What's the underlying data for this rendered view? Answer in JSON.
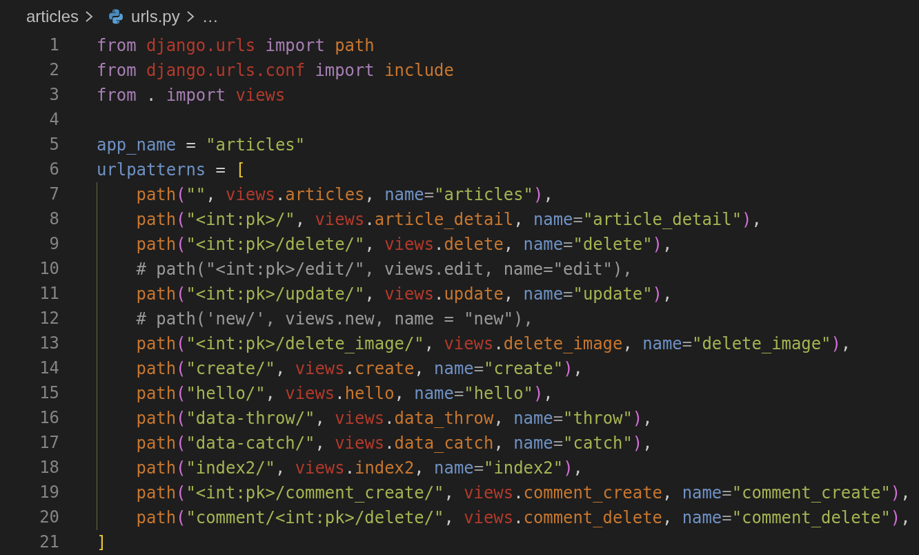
{
  "breadcrumb": {
    "folder": "articles",
    "file": "urls.py",
    "more": "…"
  },
  "lines": [
    {
      "number": "1",
      "indented": false,
      "tokens": [
        {
          "text": "from ",
          "kind": "kw"
        },
        {
          "text": "django.",
          "kind": "mod"
        },
        {
          "text": "urls ",
          "kind": "mod"
        },
        {
          "text": "import ",
          "kind": "kw"
        },
        {
          "text": "path",
          "kind": "fn"
        }
      ]
    },
    {
      "number": "2",
      "indented": false,
      "tokens": [
        {
          "text": "from ",
          "kind": "kw"
        },
        {
          "text": "django.",
          "kind": "mod"
        },
        {
          "text": "urls.",
          "kind": "mod"
        },
        {
          "text": "conf ",
          "kind": "mod"
        },
        {
          "text": "import ",
          "kind": "kw"
        },
        {
          "text": "include",
          "kind": "fn"
        }
      ]
    },
    {
      "number": "3",
      "indented": false,
      "tokens": [
        {
          "text": "from ",
          "kind": "kw"
        },
        {
          "text": ". ",
          "kind": "pl"
        },
        {
          "text": "import ",
          "kind": "kw"
        },
        {
          "text": "views",
          "kind": "mod"
        }
      ]
    },
    {
      "number": "4"
    },
    {
      "number": "5",
      "indented": false,
      "tokens": [
        {
          "text": "app_name",
          "kind": "var"
        },
        {
          "text": " = ",
          "kind": "pl"
        },
        {
          "text": "\"articles\"",
          "kind": "str"
        }
      ]
    },
    {
      "number": "6",
      "indented": false,
      "tokens": [
        {
          "text": "urlpatterns",
          "kind": "var"
        },
        {
          "text": " = ",
          "kind": "pl"
        },
        {
          "text": "[",
          "kind": "brk"
        }
      ]
    },
    {
      "number": "7",
      "indented": true,
      "tokens": [
        {
          "text": "path",
          "kind": "fn"
        },
        {
          "text": "(",
          "kind": "paren"
        },
        {
          "text": "\"\"",
          "kind": "str"
        },
        {
          "text": ", ",
          "kind": "pl"
        },
        {
          "text": "views",
          "kind": "mod"
        },
        {
          "text": ".",
          "kind": "pl"
        },
        {
          "text": "articles",
          "kind": "fn"
        },
        {
          "text": ", ",
          "kind": "pl"
        },
        {
          "text": "name",
          "kind": "par"
        },
        {
          "text": "=",
          "kind": "op"
        },
        {
          "text": "\"articles\"",
          "kind": "str"
        },
        {
          "text": ")",
          "kind": "paren"
        },
        {
          "text": ",",
          "kind": "pl"
        }
      ]
    },
    {
      "number": "8",
      "indented": true,
      "tokens": [
        {
          "text": "path",
          "kind": "fn"
        },
        {
          "text": "(",
          "kind": "paren"
        },
        {
          "text": "\"<int:pk>/\"",
          "kind": "str"
        },
        {
          "text": ", ",
          "kind": "pl"
        },
        {
          "text": "views",
          "kind": "mod"
        },
        {
          "text": ".",
          "kind": "pl"
        },
        {
          "text": "article_detail",
          "kind": "fn"
        },
        {
          "text": ", ",
          "kind": "pl"
        },
        {
          "text": "name",
          "kind": "par"
        },
        {
          "text": "=",
          "kind": "op"
        },
        {
          "text": "\"article_detail\"",
          "kind": "str"
        },
        {
          "text": ")",
          "kind": "paren"
        },
        {
          "text": ",",
          "kind": "pl"
        }
      ]
    },
    {
      "number": "9",
      "indented": true,
      "tokens": [
        {
          "text": "path",
          "kind": "fn"
        },
        {
          "text": "(",
          "kind": "paren"
        },
        {
          "text": "\"<int:pk>/delete/\"",
          "kind": "str"
        },
        {
          "text": ", ",
          "kind": "pl"
        },
        {
          "text": "views",
          "kind": "mod"
        },
        {
          "text": ".",
          "kind": "pl"
        },
        {
          "text": "delete",
          "kind": "fn"
        },
        {
          "text": ", ",
          "kind": "pl"
        },
        {
          "text": "name",
          "kind": "par"
        },
        {
          "text": "=",
          "kind": "op"
        },
        {
          "text": "\"delete\"",
          "kind": "str"
        },
        {
          "text": ")",
          "kind": "paren"
        },
        {
          "text": ",",
          "kind": "pl"
        }
      ]
    },
    {
      "number": "10",
      "indented": true,
      "tokens": [
        {
          "text": "# path(\"<int:pk>/edit/\", views.edit, name=\"edit\"),",
          "kind": "cm"
        }
      ]
    },
    {
      "number": "11",
      "indented": true,
      "tokens": [
        {
          "text": "path",
          "kind": "fn"
        },
        {
          "text": "(",
          "kind": "paren"
        },
        {
          "text": "\"<int:pk>/update/\"",
          "kind": "str"
        },
        {
          "text": ", ",
          "kind": "pl"
        },
        {
          "text": "views",
          "kind": "mod"
        },
        {
          "text": ".",
          "kind": "pl"
        },
        {
          "text": "update",
          "kind": "fn"
        },
        {
          "text": ", ",
          "kind": "pl"
        },
        {
          "text": "name",
          "kind": "par"
        },
        {
          "text": "=",
          "kind": "op"
        },
        {
          "text": "\"update\"",
          "kind": "str"
        },
        {
          "text": ")",
          "kind": "paren"
        },
        {
          "text": ",",
          "kind": "pl"
        }
      ]
    },
    {
      "number": "12",
      "indented": true,
      "tokens": [
        {
          "text": "# path('new/', views.new, name = \"new\"),",
          "kind": "cm"
        }
      ]
    },
    {
      "number": "13",
      "indented": true,
      "tokens": [
        {
          "text": "path",
          "kind": "fn"
        },
        {
          "text": "(",
          "kind": "paren"
        },
        {
          "text": "\"<int:pk>/delete_image/\"",
          "kind": "str"
        },
        {
          "text": ", ",
          "kind": "pl"
        },
        {
          "text": "views",
          "kind": "mod"
        },
        {
          "text": ".",
          "kind": "pl"
        },
        {
          "text": "delete_image",
          "kind": "fn"
        },
        {
          "text": ", ",
          "kind": "pl"
        },
        {
          "text": "name",
          "kind": "par"
        },
        {
          "text": "=",
          "kind": "op"
        },
        {
          "text": "\"delete_image\"",
          "kind": "str"
        },
        {
          "text": ")",
          "kind": "paren"
        },
        {
          "text": ",",
          "kind": "pl"
        }
      ]
    },
    {
      "number": "14",
      "indented": true,
      "tokens": [
        {
          "text": "path",
          "kind": "fn"
        },
        {
          "text": "(",
          "kind": "paren"
        },
        {
          "text": "\"create/\"",
          "kind": "str"
        },
        {
          "text": ", ",
          "kind": "pl"
        },
        {
          "text": "views",
          "kind": "mod"
        },
        {
          "text": ".",
          "kind": "pl"
        },
        {
          "text": "create",
          "kind": "fn"
        },
        {
          "text": ", ",
          "kind": "pl"
        },
        {
          "text": "name",
          "kind": "par"
        },
        {
          "text": "=",
          "kind": "op"
        },
        {
          "text": "\"create\"",
          "kind": "str"
        },
        {
          "text": ")",
          "kind": "paren"
        },
        {
          "text": ",",
          "kind": "pl"
        }
      ]
    },
    {
      "number": "15",
      "indented": true,
      "tokens": [
        {
          "text": "path",
          "kind": "fn"
        },
        {
          "text": "(",
          "kind": "paren"
        },
        {
          "text": "\"hello/\"",
          "kind": "str"
        },
        {
          "text": ", ",
          "kind": "pl"
        },
        {
          "text": "views",
          "kind": "mod"
        },
        {
          "text": ".",
          "kind": "pl"
        },
        {
          "text": "hello",
          "kind": "fn"
        },
        {
          "text": ", ",
          "kind": "pl"
        },
        {
          "text": "name",
          "kind": "par"
        },
        {
          "text": "=",
          "kind": "op"
        },
        {
          "text": "\"hello\"",
          "kind": "str"
        },
        {
          "text": ")",
          "kind": "paren"
        },
        {
          "text": ",",
          "kind": "pl"
        }
      ]
    },
    {
      "number": "16",
      "indented": true,
      "tokens": [
        {
          "text": "path",
          "kind": "fn"
        },
        {
          "text": "(",
          "kind": "paren"
        },
        {
          "text": "\"data-throw/\"",
          "kind": "str"
        },
        {
          "text": ", ",
          "kind": "pl"
        },
        {
          "text": "views",
          "kind": "mod"
        },
        {
          "text": ".",
          "kind": "pl"
        },
        {
          "text": "data_throw",
          "kind": "fn"
        },
        {
          "text": ", ",
          "kind": "pl"
        },
        {
          "text": "name",
          "kind": "par"
        },
        {
          "text": "=",
          "kind": "op"
        },
        {
          "text": "\"throw\"",
          "kind": "str"
        },
        {
          "text": ")",
          "kind": "paren"
        },
        {
          "text": ",",
          "kind": "pl"
        }
      ]
    },
    {
      "number": "17",
      "indented": true,
      "tokens": [
        {
          "text": "path",
          "kind": "fn"
        },
        {
          "text": "(",
          "kind": "paren"
        },
        {
          "text": "\"data-catch/\"",
          "kind": "str"
        },
        {
          "text": ", ",
          "kind": "pl"
        },
        {
          "text": "views",
          "kind": "mod"
        },
        {
          "text": ".",
          "kind": "pl"
        },
        {
          "text": "data_catch",
          "kind": "fn"
        },
        {
          "text": ", ",
          "kind": "pl"
        },
        {
          "text": "name",
          "kind": "par"
        },
        {
          "text": "=",
          "kind": "op"
        },
        {
          "text": "\"catch\"",
          "kind": "str"
        },
        {
          "text": ")",
          "kind": "paren"
        },
        {
          "text": ",",
          "kind": "pl"
        }
      ]
    },
    {
      "number": "18",
      "indented": true,
      "tokens": [
        {
          "text": "path",
          "kind": "fn"
        },
        {
          "text": "(",
          "kind": "paren"
        },
        {
          "text": "\"index2/\"",
          "kind": "str"
        },
        {
          "text": ", ",
          "kind": "pl"
        },
        {
          "text": "views",
          "kind": "mod"
        },
        {
          "text": ".",
          "kind": "pl"
        },
        {
          "text": "index2",
          "kind": "fn"
        },
        {
          "text": ", ",
          "kind": "pl"
        },
        {
          "text": "name",
          "kind": "par"
        },
        {
          "text": "=",
          "kind": "op"
        },
        {
          "text": "\"index2\"",
          "kind": "str"
        },
        {
          "text": ")",
          "kind": "paren"
        },
        {
          "text": ",",
          "kind": "pl"
        }
      ]
    },
    {
      "number": "19",
      "indented": true,
      "tokens": [
        {
          "text": "path",
          "kind": "fn"
        },
        {
          "text": "(",
          "kind": "paren"
        },
        {
          "text": "\"<int:pk>/comment_create/\"",
          "kind": "str"
        },
        {
          "text": ", ",
          "kind": "pl"
        },
        {
          "text": "views",
          "kind": "mod"
        },
        {
          "text": ".",
          "kind": "pl"
        },
        {
          "text": "comment_create",
          "kind": "fn"
        },
        {
          "text": ", ",
          "kind": "pl"
        },
        {
          "text": "name",
          "kind": "par"
        },
        {
          "text": "=",
          "kind": "op"
        },
        {
          "text": "\"comment_create\"",
          "kind": "str"
        },
        {
          "text": ")",
          "kind": "paren"
        },
        {
          "text": ",",
          "kind": "pl"
        }
      ]
    },
    {
      "number": "20",
      "indented": true,
      "tokens": [
        {
          "text": "path",
          "kind": "fn"
        },
        {
          "text": "(",
          "kind": "paren"
        },
        {
          "text": "\"comment/<int:pk>/delete/\"",
          "kind": "str"
        },
        {
          "text": ", ",
          "kind": "pl"
        },
        {
          "text": "views",
          "kind": "mod"
        },
        {
          "text": ".",
          "kind": "pl"
        },
        {
          "text": "comment_delete",
          "kind": "fn"
        },
        {
          "text": ", ",
          "kind": "pl"
        },
        {
          "text": "name",
          "kind": "par"
        },
        {
          "text": "=",
          "kind": "op"
        },
        {
          "text": "\"comment_delete\"",
          "kind": "str"
        },
        {
          "text": ")",
          "kind": "paren"
        },
        {
          "text": ",",
          "kind": "pl"
        }
      ]
    },
    {
      "number": "21",
      "indented": false,
      "tokens": [
        {
          "text": "]",
          "kind": "brk"
        }
      ]
    }
  ]
}
